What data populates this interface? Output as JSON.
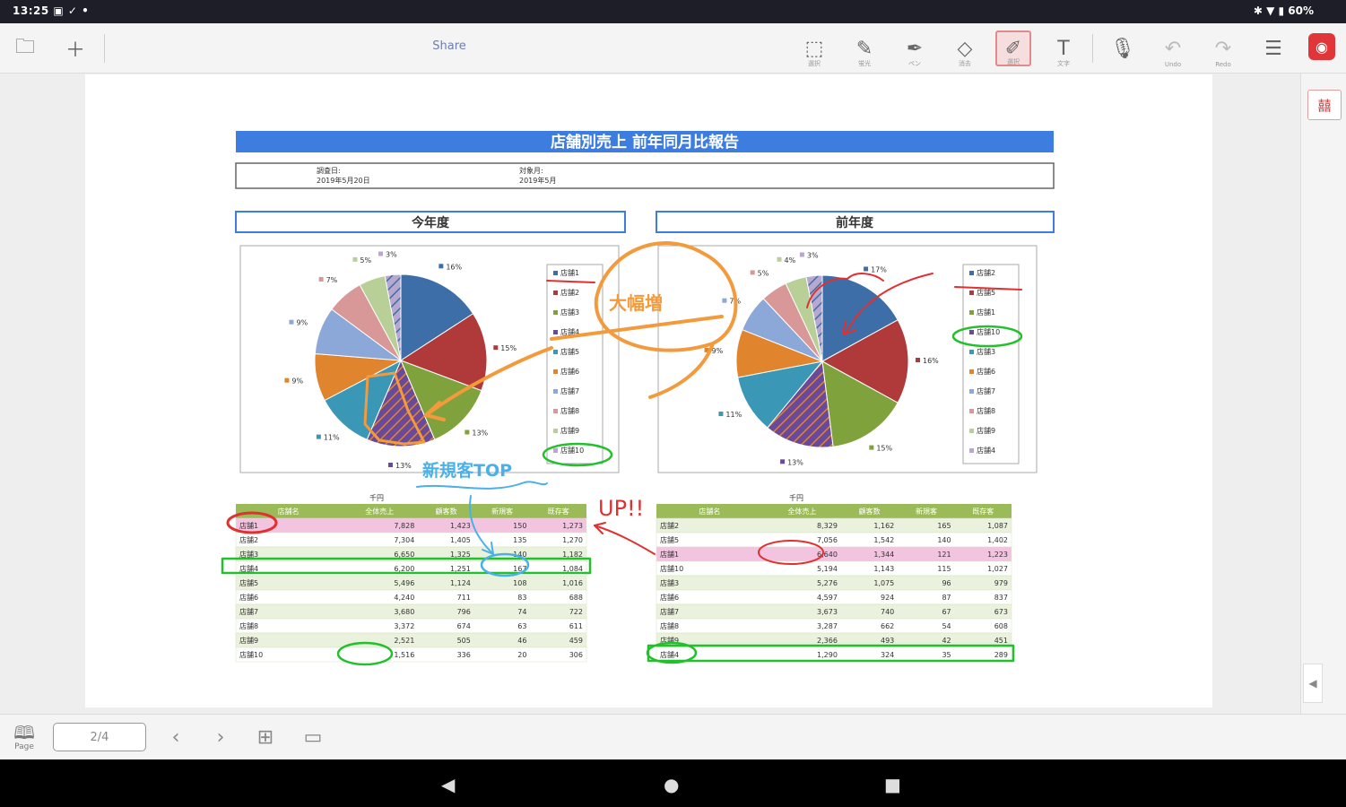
{
  "status": {
    "time": "13:25",
    "left_icons": "▣ ✓ •",
    "battery": "60%"
  },
  "toolbar": {
    "share": "Share",
    "tools": [
      {
        "id": "select",
        "glyph": "⬚",
        "caption": "選択"
      },
      {
        "id": "pen1",
        "glyph": "✎",
        "caption": "蛍光"
      },
      {
        "id": "pen2",
        "glyph": "✒",
        "caption": "ペン"
      },
      {
        "id": "eraser",
        "glyph": "◇",
        "caption": "消去"
      },
      {
        "id": "stamp",
        "glyph": "✐",
        "caption": "選択"
      },
      {
        "id": "text",
        "glyph": "T",
        "caption": "文字"
      }
    ],
    "undo": "Undo",
    "redo": "Redo"
  },
  "document": {
    "title": "店舗別売上 前年同月比報告",
    "info_left_label": "調査日:",
    "info_left_value": "2019年5月20日",
    "info_right_label": "対象月:",
    "info_right_value": "2019年5月",
    "section_current": "今年度",
    "section_previous": "前年度",
    "unit_label": "千円",
    "table_headers": [
      "店舗名",
      "全体売上",
      "顧客数",
      "新規客",
      "既存客"
    ],
    "current_table": [
      [
        "店舗1",
        "7,828",
        "1,423",
        "150",
        "1,273"
      ],
      [
        "店舗2",
        "7,304",
        "1,405",
        "135",
        "1,270"
      ],
      [
        "店舗3",
        "6,650",
        "1,325",
        "140",
        "1,182"
      ],
      [
        "店舗4",
        "6,200",
        "1,251",
        "167",
        "1,084"
      ],
      [
        "店舗5",
        "5,496",
        "1,124",
        "108",
        "1,016"
      ],
      [
        "店舗6",
        "4,240",
        "711",
        "83",
        "688"
      ],
      [
        "店舗7",
        "3,680",
        "796",
        "74",
        "722"
      ],
      [
        "店舗8",
        "3,372",
        "674",
        "63",
        "611"
      ],
      [
        "店舗9",
        "2,521",
        "505",
        "46",
        "459"
      ],
      [
        "店舗10",
        "1,516",
        "336",
        "20",
        "306"
      ]
    ],
    "previous_table": [
      [
        "店舗2",
        "8,329",
        "1,162",
        "165",
        "1,087"
      ],
      [
        "店舗5",
        "7,056",
        "1,542",
        "140",
        "1,402"
      ],
      [
        "店舗1",
        "6,640",
        "1,344",
        "121",
        "1,223"
      ],
      [
        "店舗10",
        "5,194",
        "1,143",
        "115",
        "1,027"
      ],
      [
        "店舗3",
        "5,276",
        "1,075",
        "96",
        "979"
      ],
      [
        "店舗6",
        "4,597",
        "924",
        "87",
        "837"
      ],
      [
        "店舗7",
        "3,673",
        "740",
        "67",
        "673"
      ],
      [
        "店舗8",
        "3,287",
        "662",
        "54",
        "608"
      ],
      [
        "店舗9",
        "2,366",
        "493",
        "42",
        "451"
      ],
      [
        "店舗4",
        "1,290",
        "324",
        "35",
        "289"
      ]
    ],
    "annotations": {
      "big_increase": "大幅増",
      "new_top": "新規客TOP",
      "up": "UP!!"
    }
  },
  "chart_data": [
    {
      "type": "pie",
      "title": "今年度",
      "categories": [
        "店舗1",
        "店舗2",
        "店舗3",
        "店舗4",
        "店舗5",
        "店舗6",
        "店舗7",
        "店舗8",
        "店舗9",
        "店舗10"
      ],
      "values": [
        16,
        15,
        13,
        13,
        11,
        9,
        9,
        7,
        5,
        3
      ],
      "labels": [
        "16%",
        "15%",
        "13%",
        "13%",
        "11%",
        "9%",
        "9%",
        "7%",
        "5%",
        "3%"
      ],
      "colors": [
        "#3d6ea8",
        "#b03a3a",
        "#80a23c",
        "#6a4a98",
        "#3a98b6",
        "#e0842e",
        "#8ca8d8",
        "#d89898",
        "#b8d098",
        "#b8a8d0"
      ],
      "legend": [
        "店舗1",
        "店舗2",
        "店舗3",
        "店舗4",
        "店舗5",
        "店舗6",
        "店舗7",
        "店舗8",
        "店舗9",
        "店舗10"
      ],
      "legend_position": "right"
    },
    {
      "type": "pie",
      "title": "前年度",
      "categories": [
        "店舗2",
        "店舗5",
        "店舗1",
        "店舗10",
        "店舗3",
        "店舗6",
        "店舗7",
        "店舗8",
        "店舗9",
        "店舗4"
      ],
      "values": [
        17,
        16,
        15,
        13,
        11,
        9,
        7,
        5,
        4,
        3
      ],
      "labels": [
        "17%",
        "16%",
        "15%",
        "13%",
        "11%",
        "9%",
        "7%",
        "5%",
        "4%",
        "3%"
      ],
      "colors": [
        "#3d6ea8",
        "#b03a3a",
        "#80a23c",
        "#6a4a98",
        "#3a98b6",
        "#e0842e",
        "#8ca8d8",
        "#d89898",
        "#b8d098",
        "#b8a8d0"
      ],
      "legend": [
        "店舗2",
        "店舗5",
        "店舗1",
        "店舗10",
        "店舗3",
        "店舗6",
        "店舗7",
        "店舗8",
        "店舗9",
        "店舗4"
      ],
      "legend_position": "right"
    }
  ],
  "bottombar": {
    "page_label": "Page",
    "pager": "2/4"
  }
}
